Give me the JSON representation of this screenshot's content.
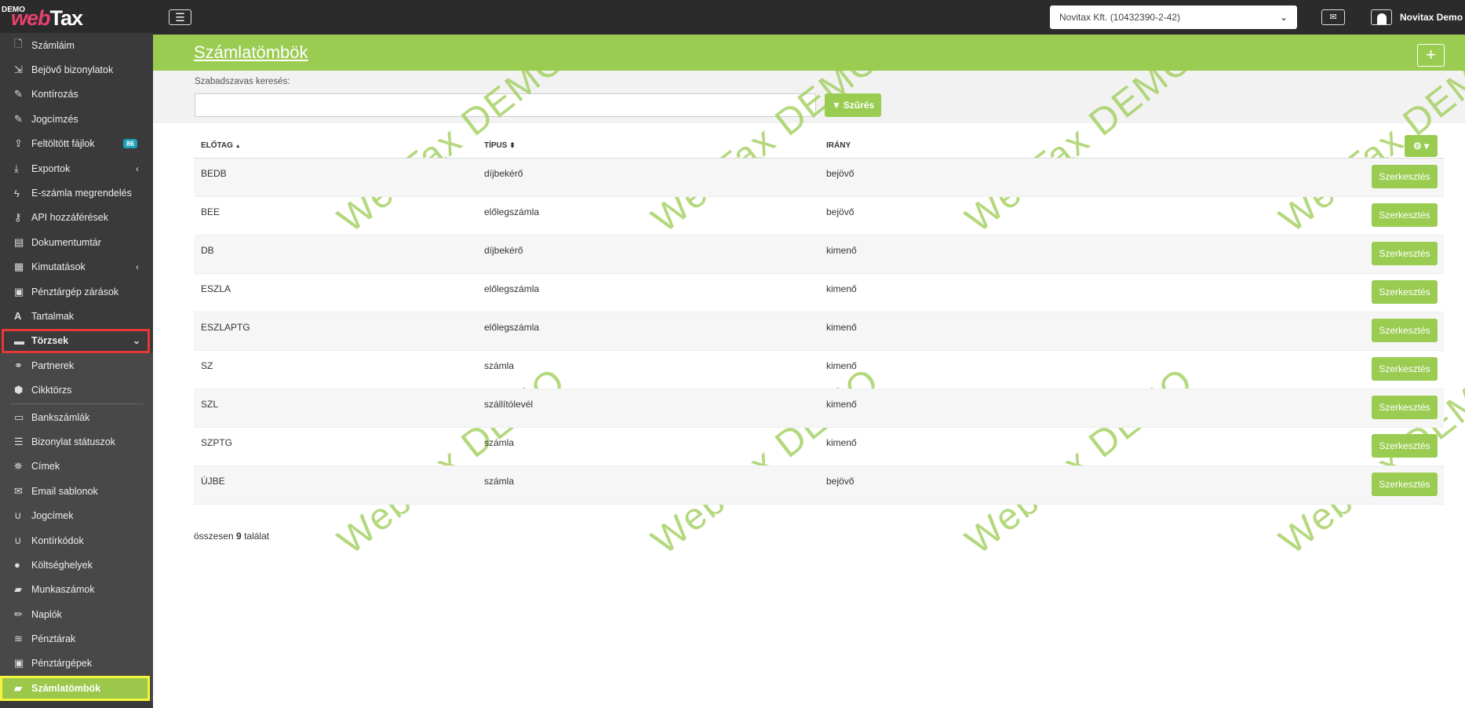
{
  "logo": {
    "demo": "DEMO",
    "brand_web": "web",
    "brand_tax": "Tax"
  },
  "sidebar": {
    "items": [
      {
        "label": "Számláim",
        "icon": "file-icon"
      },
      {
        "label": "Bejövő bizonylatok",
        "icon": "file-import-icon"
      },
      {
        "label": "Kontírozás",
        "icon": "edit-icon"
      },
      {
        "label": "Jogcímzés",
        "icon": "edit-icon"
      },
      {
        "label": "Feltöltött fájlok",
        "icon": "upload-icon",
        "badge": "86"
      },
      {
        "label": "Exportok",
        "icon": "download-icon"
      },
      {
        "label": "E-számla megrendelés",
        "icon": "bolt-icon"
      },
      {
        "label": "API hozzáférések",
        "icon": "key-icon"
      },
      {
        "label": "Dokumentumtár",
        "icon": "archive-icon"
      },
      {
        "label": "Kimutatások",
        "icon": "chart-icon"
      },
      {
        "label": "Pénztárgép zárások",
        "icon": "cash-register-icon"
      },
      {
        "label": "Tartalmak",
        "icon": "font-icon"
      },
      {
        "label": "Törzsek",
        "icon": "book-icon"
      }
    ],
    "sub_items": [
      {
        "label": "Partnerek",
        "icon": "handshake-icon"
      },
      {
        "label": "Cikktörzs",
        "icon": "box-icon"
      },
      {
        "label": "Bankszámlák",
        "icon": "credit-card-icon"
      },
      {
        "label": "Bizonylat státuszok",
        "icon": "list-icon"
      },
      {
        "label": "Címek",
        "icon": "map-icon"
      },
      {
        "label": "Email sablonok",
        "icon": "envelope-icon"
      },
      {
        "label": "Jogcímek",
        "icon": "magnet-icon"
      },
      {
        "label": "Kontírkódok",
        "icon": "magnet-icon"
      },
      {
        "label": "Költséghelyek",
        "icon": "map-marker-icon"
      },
      {
        "label": "Munkaszámok",
        "icon": "briefcase-icon"
      },
      {
        "label": "Naplók",
        "icon": "pen-icon"
      },
      {
        "label": "Pénztárak",
        "icon": "coins-icon"
      },
      {
        "label": "Pénztárgépek",
        "icon": "cash-register-icon"
      },
      {
        "label": "Számlatömbök",
        "icon": "folder-icon"
      }
    ]
  },
  "topbar": {
    "company": "Novitax Kft. (10432390-2-42)",
    "user": "Novitax Demo"
  },
  "header": {
    "title": "Számlatömbök"
  },
  "filter": {
    "label": "Szabadszavas keresés:",
    "value": "",
    "button": "Szűrés"
  },
  "watermark": "WebTax DEMO",
  "table": {
    "headers": [
      "ELŐTAG",
      "TÍPUS",
      "IRÁNY"
    ],
    "sort_indicators": [
      "▲",
      "⬍"
    ],
    "edit_label": "Szerkesztés",
    "rows": [
      {
        "prefix": "BEDB",
        "type": "díjbekérő",
        "direction": "bejövő"
      },
      {
        "prefix": "BEE",
        "type": "előlegszámla",
        "direction": "bejövő"
      },
      {
        "prefix": "DB",
        "type": "díjbekérő",
        "direction": "kimenő"
      },
      {
        "prefix": "ESZLA",
        "type": "előlegszámla",
        "direction": "kimenő"
      },
      {
        "prefix": "ESZLAPTG",
        "type": "előlegszámla",
        "direction": "kimenő"
      },
      {
        "prefix": "SZ",
        "type": "számla",
        "direction": "kimenő"
      },
      {
        "prefix": "SZL",
        "type": "szállítólevél",
        "direction": "kimenő"
      },
      {
        "prefix": "SZPTG",
        "type": "számla",
        "direction": "kimenő"
      },
      {
        "prefix": "ÚJBE",
        "type": "számla",
        "direction": "bejövő"
      }
    ]
  },
  "summary": {
    "prefix": "összesen",
    "count": "9",
    "suffix": "találat"
  },
  "colors": {
    "accent": "#9bcc52",
    "sidebar": "#3a3a3a",
    "topbar": "#2b2b2b",
    "badge": "#1aa0b8"
  }
}
